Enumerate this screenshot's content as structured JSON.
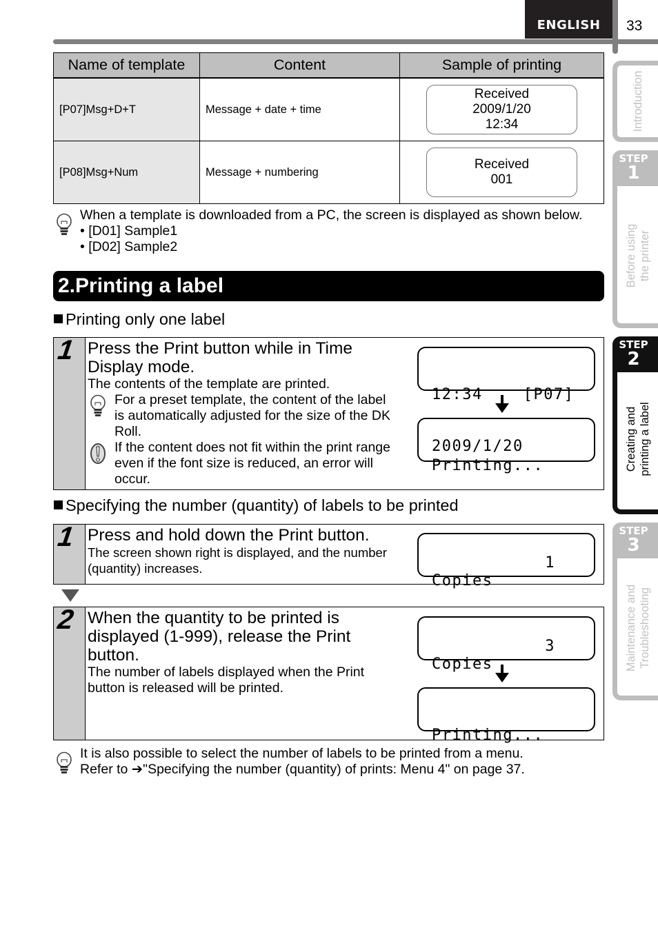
{
  "header": {
    "language": "ENGLISH",
    "page_number": "33"
  },
  "side_tabs": {
    "intro": {
      "label": "Introduction"
    },
    "steps": [
      {
        "step_word": "STEP",
        "number": "1",
        "label_lines": [
          "Before using",
          "the printer"
        ],
        "active": false
      },
      {
        "step_word": "STEP",
        "number": "2",
        "label_lines": [
          "Creating and",
          "printing a label"
        ],
        "active": true
      },
      {
        "step_word": "STEP",
        "number": "3",
        "label_lines": [
          "Maintenance and",
          "Troubleshooting"
        ],
        "active": false
      }
    ]
  },
  "template_table": {
    "headers": [
      "Name of template",
      "Content",
      "Sample of printing"
    ],
    "rows": [
      {
        "name": "[P07]Msg+D+T",
        "content": "Message + date + time",
        "sample_lines": [
          "Received",
          "2009/1/20",
          "12:34"
        ]
      },
      {
        "name": "[P08]Msg+Num",
        "content": "Message + numbering",
        "sample_lines": [
          "Received",
          "001"
        ]
      }
    ]
  },
  "hint_download": {
    "icon": "lightbulb-icon",
    "text": "When a template is downloaded from a PC, the screen is displayed as shown below.",
    "bullets": [
      "• [D01] Sample1",
      "• [D02] Sample2"
    ]
  },
  "section": {
    "title": "2.Printing a label"
  },
  "single_label": {
    "heading": "Printing only one label",
    "step": {
      "number": "1",
      "main_lines": [
        "Press the Print button while in Time",
        "Display mode."
      ],
      "sub": "The contents of the template are printed.",
      "hint_note_lines": [
        "For a preset template, the content of the label",
        "is automatically adjusted for the size of the DK",
        "Roll."
      ],
      "warning_note_lines": [
        "If the content does not fit within the print range",
        "even if the font size is reduced, an error will",
        "occur."
      ],
      "lcd_before": {
        "line1": "12:34    [P07]",
        "line2": "2009/1/20"
      },
      "lcd_after": {
        "line1": "Printing..."
      }
    }
  },
  "quantity": {
    "heading": "Specifying the number (quantity) of labels to be printed",
    "step1": {
      "number": "1",
      "main": "Press and hold down the Print button.",
      "sub_lines": [
        "The screen shown right is displayed, and the number",
        "(quantity) increases."
      ],
      "lcd": {
        "line1": "Copies",
        "value": "1"
      }
    },
    "step2": {
      "number": "2",
      "main_lines": [
        "When the quantity to be printed is",
        "displayed (1-999), release the Print",
        "button."
      ],
      "sub_lines": [
        "The number of labels displayed when the Print",
        "button is released will be printed."
      ],
      "lcd_before": {
        "line1": "Copies",
        "value": "3"
      },
      "lcd_after": {
        "line1": "Printing..."
      }
    }
  },
  "hint_menu": {
    "icon": "lightbulb-icon",
    "line1": "It is also possible to select the number of labels to be printed from a menu.",
    "line2_prefix": "Refer to ",
    "line2_arrow": "➔",
    "line2_link": "\"Specifying the number (quantity) of prints: Menu 4\" on page 37."
  }
}
